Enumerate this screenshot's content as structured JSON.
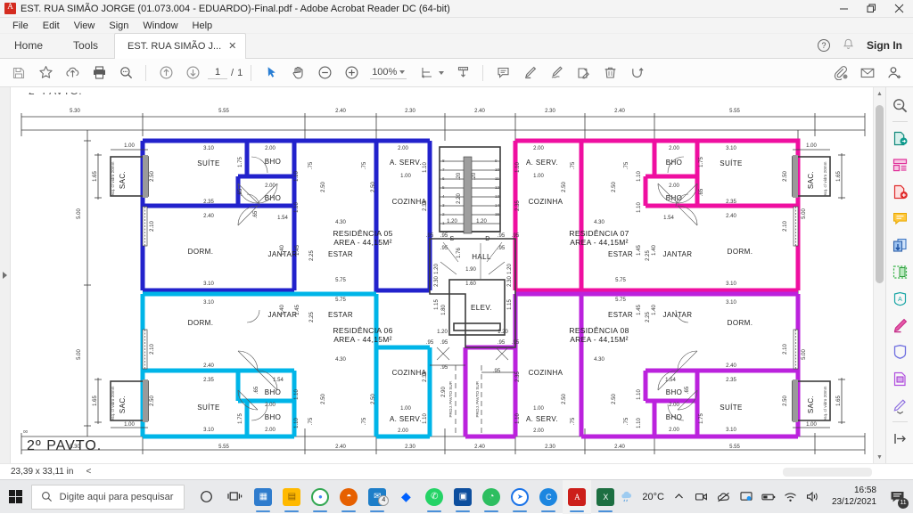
{
  "window": {
    "title": "EST. RUA SIMÃO JORGE (01.073.004 - EDUARDO)-Final.pdf - Adobe Acrobat Reader DC (64-bit)",
    "app_icon": "pdf-icon",
    "minimize": "–",
    "restore": "❐",
    "close": "✕"
  },
  "menubar": {
    "items": [
      "File",
      "Edit",
      "View",
      "Sign",
      "Window",
      "Help"
    ]
  },
  "tabs": {
    "home": "Home",
    "tools": "Tools",
    "document": "EST. RUA SIMÃO J...",
    "close_glyph": "✕",
    "help_glyph": "?",
    "sign_in": "Sign In"
  },
  "toolbar": {
    "save": "save-icon",
    "star": "add-to-favorites-icon",
    "upload": "upload-cloud-icon",
    "print": "print-icon",
    "findtext": "find-text-icon",
    "prev_page": "previous-page-icon",
    "next_page": "next-page-icon",
    "page_current": "1",
    "page_sep": "/",
    "page_total": "1",
    "select": "select-cursor-icon",
    "hand": "pan-hand-icon",
    "zoom_out": "zoom-out-icon",
    "zoom_in": "zoom-in-icon",
    "zoom_level": "100%",
    "fit_page": "fit-page-icon",
    "read_mode": "read-mode-icon",
    "comment": "add-comment-icon",
    "highlight": "highlight-icon",
    "draw": "draw-freehand-icon",
    "stamp": "stamp-icon",
    "delete": "delete-icon",
    "rotate": "rotate-icon",
    "attach": "attach-file-icon",
    "email": "email-icon",
    "add_user": "add-user-icon"
  },
  "right_pane": {
    "items": [
      "search-tool-icon",
      "export-pdf-icon",
      "organize-pages-icon",
      "create-pdf-icon",
      "comment-tool-icon",
      "combine-files-icon",
      "crop-pages-icon",
      "protect-icon",
      "edit-pdf-icon",
      "redact-icon",
      "fill-sign-icon",
      "more-tools-icon",
      "collapse-pane-icon"
    ]
  },
  "status": {
    "page_size": "23,39 x 33,11 in",
    "chevron": "<"
  },
  "taskbar": {
    "search_placeholder": "Digite aqui para pesquisar",
    "start": "windows-start-icon",
    "cortana": "cortana-icon",
    "task_view": "task-view-icon",
    "apps": [
      {
        "name": "microsoft-store-icon",
        "color": "#2f7ccd",
        "letter": "▦",
        "running": true
      },
      {
        "name": "file-explorer-icon",
        "color": "#ffb900",
        "letter": "▤",
        "running": true
      },
      {
        "name": "google-chrome-icon",
        "color": "#4285f4",
        "letter": "◉",
        "running": true
      },
      {
        "name": "mozilla-firefox-icon",
        "color": "#e66000",
        "letter": "◓",
        "running": true
      },
      {
        "name": "mail-icon",
        "color": "#1e7ec8",
        "letter": "✉",
        "running": true,
        "badge": "4"
      },
      {
        "name": "dropbox-icon",
        "color": "#0061ff",
        "letter": "◆",
        "running": false
      },
      {
        "name": "whatsapp-icon",
        "color": "#25d366",
        "letter": "✆",
        "running": true
      },
      {
        "name": "teamviewer-icon",
        "color": "#0e4f9e",
        "letter": "▣",
        "running": true
      },
      {
        "name": "evernote-icon",
        "color": "#2dbe60",
        "letter": "◔",
        "running": true
      },
      {
        "name": "sync-app-icon",
        "color": "#1a73e8",
        "letter": "➤",
        "running": true
      },
      {
        "name": "opera-browser-icon",
        "color": "#1c86e0",
        "letter": "C",
        "running": true
      },
      {
        "name": "adobe-acrobat-icon",
        "color": "#cc1f1a",
        "letter": "A",
        "running": true,
        "active": true
      },
      {
        "name": "microsoft-excel-icon",
        "color": "#1d6f42",
        "letter": "X",
        "running": true
      }
    ],
    "tray": {
      "weather_temp": "20°C",
      "weather_icon": "cloud-rain-icon",
      "show_hidden": "show-hidden-icons-icon",
      "meet_now": "meet-now-icon",
      "onedrive": "onedrive-icon",
      "display": "display-settings-icon",
      "battery": "battery-icon",
      "network": "wifi-icon",
      "volume": "volume-icon",
      "time": "16:58",
      "date": "23/12/2021",
      "notifications_count": "11",
      "notification_icon": "action-center-icon"
    }
  },
  "floorplan": {
    "title": "2º PAVTO.",
    "colors": {
      "blue": "#2222cc",
      "cyan": "#00b5e8",
      "magenta": "#ef0fa0",
      "purple": "#bb22dd",
      "line": "#3a3a3a",
      "thin": "#6a6a6a"
    },
    "top_dimensions": [
      "5.30",
      "5.55",
      "2.40",
      "2.30",
      "2.40",
      "2.30",
      "2.40",
      "5.55"
    ],
    "bottom_dimensions": [
      "5.30",
      "5.55",
      "2.40",
      "2.30",
      "2.40",
      "2.30",
      "2.40",
      "5.55"
    ],
    "left_dimensions": [
      "5.00",
      "5.00"
    ],
    "right_dimensions": [
      "5.00",
      "5.00"
    ],
    "units_text": [
      "1.65",
      "1.00",
      "1.65",
      "1.00"
    ],
    "residences": [
      {
        "id": "r05",
        "name": "RESIDÊNCIA 05",
        "area": "AREA - 44,15M²"
      },
      {
        "id": "r06",
        "name": "RESIDÊNCIA 06",
        "area": "AREA - 44,15M²"
      },
      {
        "id": "r07",
        "name": "RESIDÊNCIA 07",
        "area": "AREA - 44,15M²"
      },
      {
        "id": "r08",
        "name": "RESIDÊNCIA 08",
        "area": "AREA - 44,15M²"
      }
    ],
    "room_labels": [
      "SUÍTE",
      "DORM.",
      "BHO",
      "BHO",
      "SAC.",
      "ESTAR",
      "JANTAR",
      "COZINHA",
      "A. SERV.",
      "HALL",
      "ELEV."
    ],
    "core_labels": {
      "hall": "HALL",
      "elev": "ELEV.",
      "stair_s": "S",
      "stair_d": "D"
    },
    "common_dims": {
      "d310": "3.10",
      "d250": "2.50",
      "d240": "2.40",
      "d235": "2.35",
      "d210": "2.10",
      "d200": "2.00",
      "d175": "1.75",
      "d154": "1.54",
      "d145": "1.45",
      "d140": "1.40",
      "d120": "1.20",
      "d110": "1.10",
      "d100": "1.00",
      "d095": ".95",
      "d075": ".75",
      "d065": ".65",
      "d575": "5.75",
      "d430": "4.30",
      "d225": "2.25",
      "d190": "1.90",
      "d160": "1.60",
      "d230": "2.30",
      "d290": "2.90",
      "d180": "1.80",
      "d115": "1.15",
      "d176": "1.76"
    },
    "sac_note": "esq. c/ vidro 20mm",
    "proj_note": "PROJ. PAVTO SUP."
  }
}
